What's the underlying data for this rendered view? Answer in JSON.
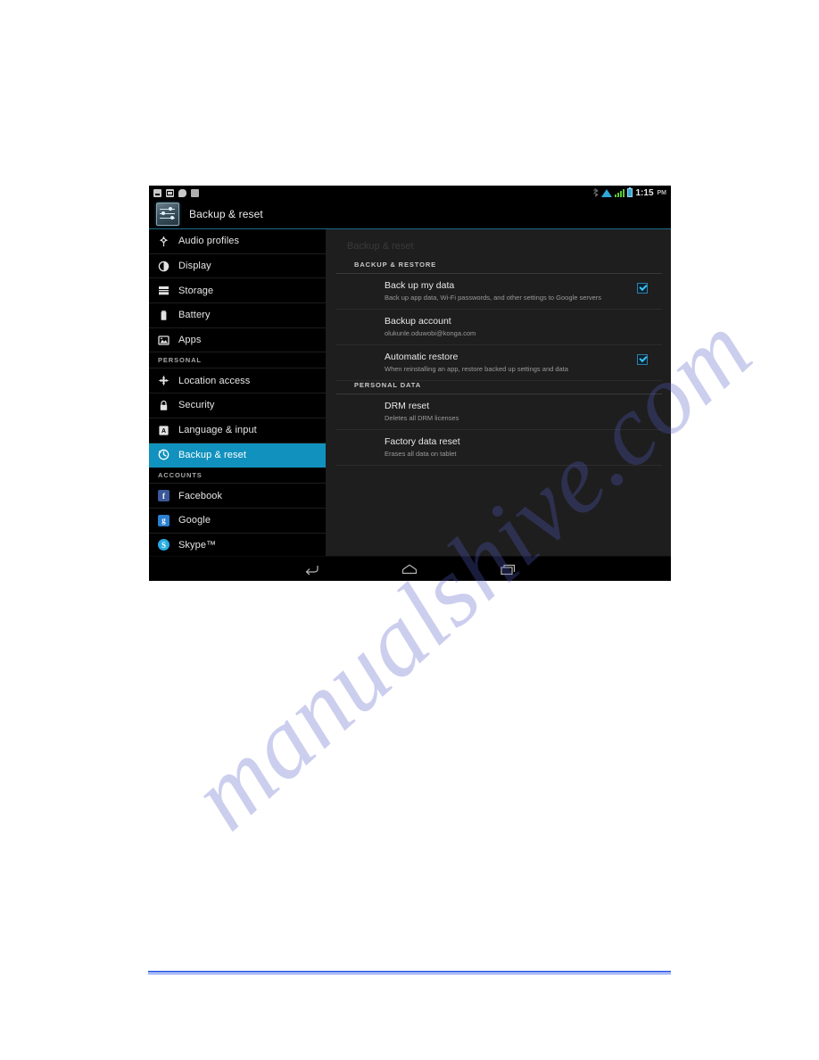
{
  "watermark": {
    "text": "manualshive.com"
  },
  "tablet": {
    "status_bar": {
      "notification_icons": [
        "download-icon",
        "mail-icon",
        "chat-icon",
        "apps-icon"
      ],
      "system_icons": [
        "bluetooth-icon",
        "wifi-icon",
        "signal-icon",
        "battery-icon"
      ],
      "time": "1:15",
      "ampm": "PM"
    },
    "action_bar": {
      "icon": "settings-sliders-icon",
      "title": "Backup & reset"
    },
    "sidebar": {
      "items": [
        {
          "label": "Audio profiles",
          "icon": "audio-profiles-icon",
          "type": "item",
          "selected": false
        },
        {
          "label": "Display",
          "icon": "display-icon",
          "type": "item",
          "selected": false
        },
        {
          "label": "Storage",
          "icon": "storage-icon",
          "type": "item",
          "selected": false
        },
        {
          "label": "Battery",
          "icon": "battery-icon",
          "type": "item",
          "selected": false
        },
        {
          "label": "Apps",
          "icon": "apps-icon",
          "type": "item",
          "selected": false
        },
        {
          "label": "PERSONAL",
          "icon": "",
          "type": "heading",
          "selected": false
        },
        {
          "label": "Location access",
          "icon": "location-icon",
          "type": "item",
          "selected": false
        },
        {
          "label": "Security",
          "icon": "lock-icon",
          "type": "item",
          "selected": false
        },
        {
          "label": "Language & input",
          "icon": "language-icon",
          "type": "item",
          "selected": false
        },
        {
          "label": "Backup & reset",
          "icon": "backup-reset-icon",
          "type": "item",
          "selected": true
        },
        {
          "label": "ACCOUNTS",
          "icon": "",
          "type": "heading",
          "selected": false
        },
        {
          "label": "Facebook",
          "icon": "facebook-icon",
          "type": "item",
          "selected": false
        },
        {
          "label": "Google",
          "icon": "google-icon",
          "type": "item",
          "selected": false
        },
        {
          "label": "Skype™",
          "icon": "skype-icon",
          "type": "item",
          "selected": false
        }
      ]
    },
    "content": {
      "title": "Backup & reset",
      "sections": [
        {
          "heading": "BACKUP & RESTORE",
          "rows": [
            {
              "title": "Back up my data",
              "subtitle": "Back up app data, Wi-Fi passwords, and other settings to Google servers",
              "checkbox": true,
              "checked": true
            },
            {
              "title": "Backup account",
              "subtitle": "olukunle.oduwobi@konga.com",
              "checkbox": false,
              "checked": false
            },
            {
              "title": "Automatic restore",
              "subtitle": "When reinstalling an app, restore backed up settings and data",
              "checkbox": true,
              "checked": true
            }
          ]
        },
        {
          "heading": "PERSONAL DATA",
          "rows": [
            {
              "title": "DRM reset",
              "subtitle": "Deletes all DRM licenses",
              "checkbox": false,
              "checked": false
            },
            {
              "title": "Factory data reset",
              "subtitle": "Erases all data on tablet",
              "checkbox": false,
              "checked": false
            }
          ]
        }
      ]
    },
    "nav_bar": {
      "buttons": [
        {
          "icon": "back-icon"
        },
        {
          "icon": "home-icon"
        },
        {
          "icon": "recents-icon"
        }
      ]
    }
  },
  "colors": {
    "accent_selected": "#1191bd",
    "checkbox_check": "#39c3f0",
    "content_bg": "#1e1e1e",
    "sidebar_bg": "#000000",
    "footer_rule": "#4169e8",
    "watermark": "#565cc8"
  }
}
